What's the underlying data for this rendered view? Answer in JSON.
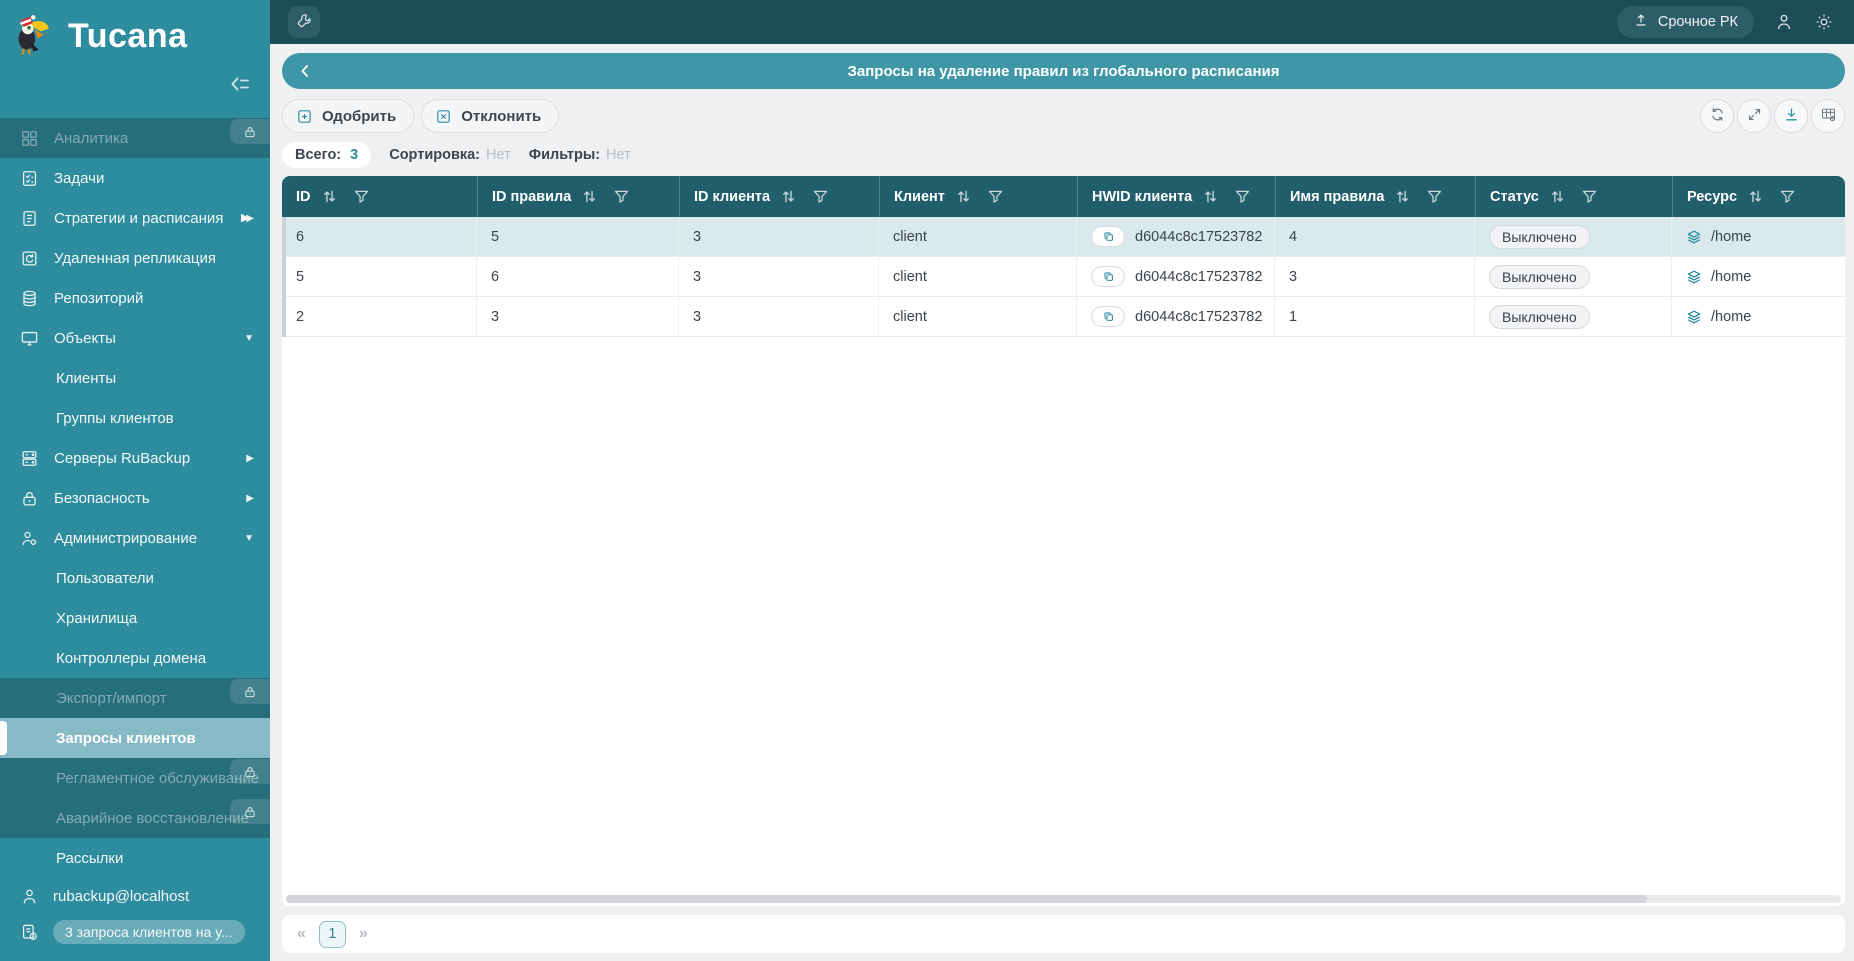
{
  "app": {
    "name": "Tucana",
    "logo_icon": "toucan-santa-hat"
  },
  "topbar": {
    "tools_icon": "wrench",
    "urgent_label": "Срочное РК",
    "urgent_icon": "upload",
    "right_icons": [
      "user",
      "gear"
    ]
  },
  "page": {
    "title": "Запросы на удаление правил из глобального расписания",
    "back_icon": "chevron-left"
  },
  "toolbar": {
    "approve": "Одобрить",
    "approve_icon": "plus-square",
    "reject": "Отклонить",
    "reject_icon": "x-square",
    "right_icons": [
      "refresh",
      "fullscreen",
      "download",
      "table-settings"
    ]
  },
  "summary": {
    "total_label": "Всего:",
    "total_value": "3",
    "sort_label": "Сортировка:",
    "sort_value": "Нет",
    "filter_label": "Фильтры:",
    "filter_value": "Нет"
  },
  "table": {
    "columns": [
      "ID",
      "ID правила",
      "ID клиента",
      "Клиент",
      "HWID клиента",
      "Имя правила",
      "Статус",
      "Ресурс"
    ],
    "column_keys": [
      "id",
      "rule_id",
      "client_id",
      "client",
      "hwid",
      "rule_name",
      "status",
      "resource"
    ],
    "header_icons": [
      "sort",
      "filter-funnel"
    ],
    "hwid_icon": "copy",
    "resource_icon": "layers",
    "rows": [
      {
        "id": "6",
        "rule_id": "5",
        "client_id": "3",
        "client": "client",
        "hwid": "d6044c8c17523782",
        "rule_name": "4",
        "status": "Выключено",
        "resource": "/home",
        "selected": true
      },
      {
        "id": "5",
        "rule_id": "6",
        "client_id": "3",
        "client": "client",
        "hwid": "d6044c8c17523782",
        "rule_name": "3",
        "status": "Выключено",
        "resource": "/home",
        "selected": false
      },
      {
        "id": "2",
        "rule_id": "3",
        "client_id": "3",
        "client": "client",
        "hwid": "d6044c8c17523782",
        "rule_name": "1",
        "status": "Выключено",
        "resource": "/home",
        "selected": false
      }
    ]
  },
  "pagination": {
    "first": "«",
    "current": "1",
    "last": "»"
  },
  "sidebar": {
    "collapse_icon": "collapse-panel",
    "items": [
      {
        "name": "analytics",
        "label": "Аналитика",
        "icon": "grid",
        "locked": true
      },
      {
        "name": "tasks",
        "label": "Задачи",
        "icon": "tasks"
      },
      {
        "name": "strategies-schedules",
        "label": "Стратегии и расписания",
        "icon": "strategy",
        "arrow": "right"
      },
      {
        "name": "remote-replication",
        "label": "Удаленная репликация",
        "icon": "replication"
      },
      {
        "name": "repository",
        "label": "Репозиторий",
        "icon": "database"
      },
      {
        "name": "objects",
        "label": "Объекты",
        "icon": "monitor",
        "arrow": "down"
      },
      {
        "name": "clients",
        "label": "Клиенты",
        "child": true
      },
      {
        "name": "client-groups",
        "label": "Группы клиентов",
        "child": true
      },
      {
        "name": "rubackup-servers",
        "label": "Серверы RuBackup",
        "icon": "server",
        "arrow": "right"
      },
      {
        "name": "security",
        "label": "Безопасность",
        "icon": "lock",
        "arrow": "right"
      },
      {
        "name": "administration",
        "label": "Администрирование",
        "icon": "admin",
        "arrow": "down"
      },
      {
        "name": "users",
        "label": "Пользователи",
        "child": true
      },
      {
        "name": "storages",
        "label": "Хранилища",
        "child": true
      },
      {
        "name": "domain-controllers",
        "label": "Контроллеры домена",
        "child": true
      },
      {
        "name": "export-import",
        "label": "Экспорт/импорт",
        "child": true,
        "locked": true
      },
      {
        "name": "client-requests",
        "label": "Запросы клиентов",
        "child": true,
        "active": true
      },
      {
        "name": "scheduled-maintenance",
        "label": "Регламентное обслуживание",
        "child": true,
        "locked": true
      },
      {
        "name": "disaster-recovery",
        "label": "Аварийное восстановление",
        "child": true,
        "locked": true
      },
      {
        "name": "mailings",
        "label": "Рассылки",
        "child": true
      }
    ],
    "user": "rubackup@localhost",
    "user_icon": "user",
    "badge": "3 запроса клиентов на у...",
    "badge_icon": "doc-clock"
  },
  "colors": {
    "accent_teal": "#2e8fa0",
    "sidebar_bg": "#2e8c9f",
    "topbar_bg": "#1c4c58",
    "title_bar_bg": "#3f96a6",
    "table_header_bg": "#205e6b",
    "selected_row_bg": "#d9e9ec",
    "locked_item_bg": "#276e7d",
    "active_item_bg": "#86bac6",
    "page_bg": "#eef0f2"
  }
}
